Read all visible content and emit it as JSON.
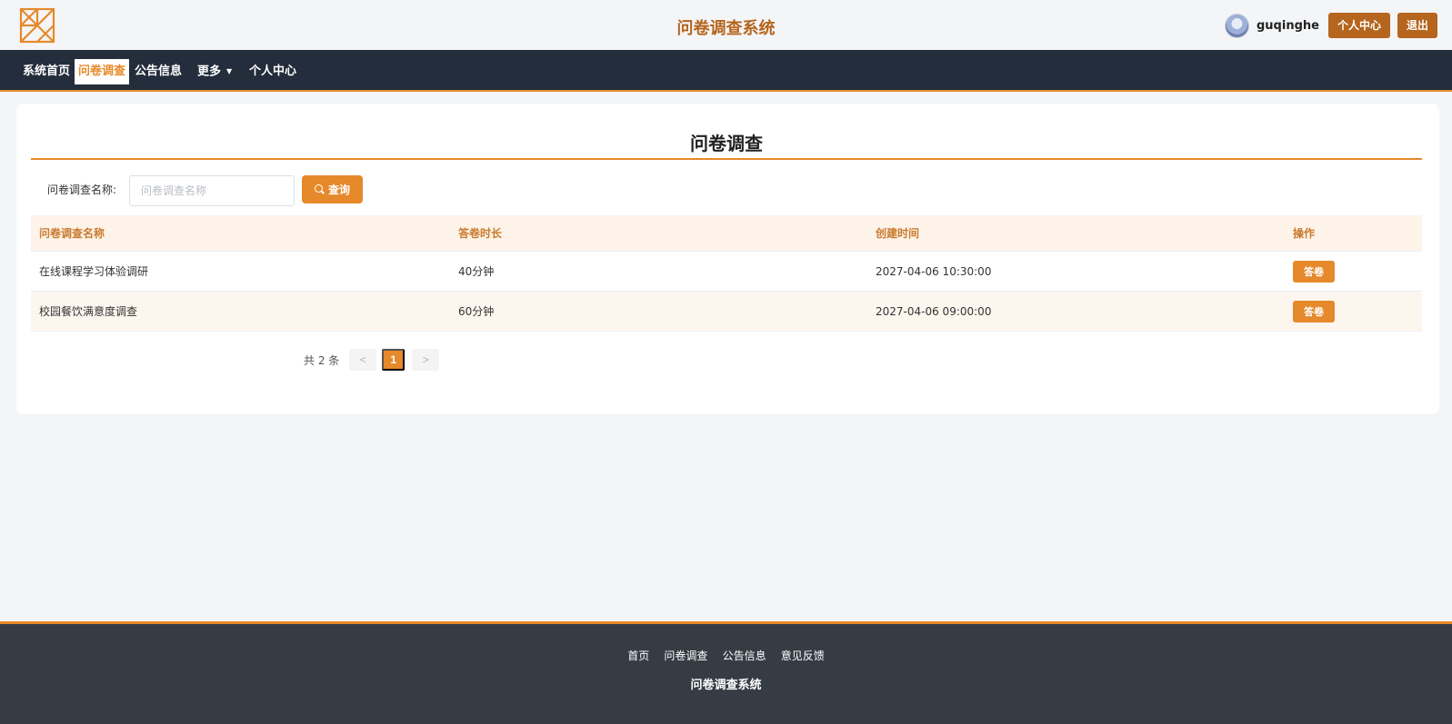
{
  "header": {
    "site_title": "问卷调查系统",
    "username": "guqinghe",
    "profile_button": "个人中心",
    "logout_button": "退出",
    "accent_color": "#b5651d"
  },
  "nav": {
    "items": [
      {
        "label": "系统首页"
      },
      {
        "label": "问卷调查",
        "active": true
      },
      {
        "label": "公告信息"
      },
      {
        "label": "更多"
      },
      {
        "label": "个人中心"
      }
    ],
    "more_caret": "▼"
  },
  "main": {
    "title": "问卷调查",
    "search": {
      "label": "问卷调查名称:",
      "placeholder": "问卷调查名称",
      "value": "",
      "button_label": "查询"
    },
    "table": {
      "columns": [
        "问卷调查名称",
        "答卷时长",
        "创建时间",
        "操作"
      ],
      "rows": [
        {
          "name": "在线课程学习体验调研",
          "duration": "40分钟",
          "created": "2027-04-06 10:30:00",
          "action": "答卷"
        },
        {
          "name": "校园餐饮满意度调查",
          "duration": "60分钟",
          "created": "2027-04-06 09:00:00",
          "action": "答卷"
        }
      ]
    },
    "pagination": {
      "total_text": "共 2 条",
      "prev": "<",
      "current_page": "1",
      "next": ">"
    }
  },
  "footer": {
    "links": [
      "首页",
      "问卷调查",
      "公告信息",
      "意见反馈"
    ],
    "title": "问卷调查系统",
    "accent_color": "#e6892a"
  }
}
